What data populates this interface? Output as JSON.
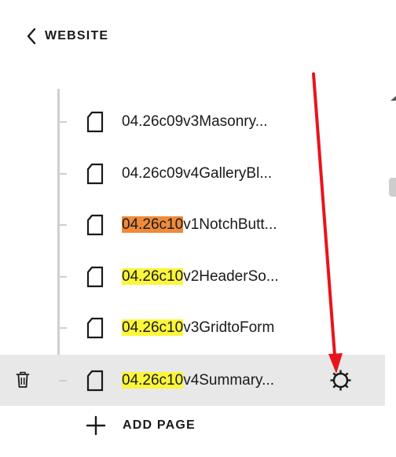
{
  "nav": {
    "back_label": "WEBSITE"
  },
  "pages": [
    {
      "prefix": "",
      "rest": "04.26c09v3Masonry...",
      "highlight": "none",
      "selected": false
    },
    {
      "prefix": "",
      "rest": "04.26c09v4GalleryBl...",
      "highlight": "none",
      "selected": false
    },
    {
      "prefix": "04.26c10",
      "rest": "v1NotchButt...",
      "highlight": "orange",
      "selected": false
    },
    {
      "prefix": "04.26c10",
      "rest": "v2HeaderSo...",
      "highlight": "yellow",
      "selected": false
    },
    {
      "prefix": "04.26c10",
      "rest": "v3GridtoForm",
      "highlight": "yellow",
      "selected": false
    },
    {
      "prefix": "04.26c10",
      "rest": "v4Summary...",
      "highlight": "yellow",
      "selected": true
    }
  ],
  "add_page_label": "ADD PAGE",
  "icons": {
    "back": "chevron-left-icon",
    "page": "page-icon",
    "delete": "trash-icon",
    "settings": "gear-icon",
    "add": "plus-icon"
  },
  "colors": {
    "selected_row": "#e8e8e8",
    "highlight_orange": "#ee8b3a",
    "highlight_yellow": "#fbf63b",
    "annotation_arrow": "#e8141c"
  }
}
